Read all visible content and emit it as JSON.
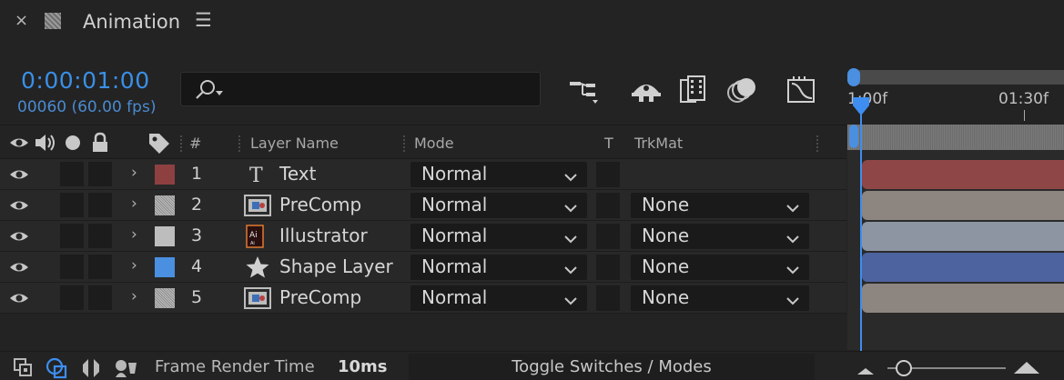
{
  "panel": {
    "close_glyph": "×",
    "title": "Animation",
    "menu_glyph": "☰",
    "icon": "composition-icon"
  },
  "time": {
    "timecode": "0:00:01:00",
    "frames_fps": "00060 (60.00 fps)"
  },
  "search": {
    "placeholder": "",
    "icon": "search-icon"
  },
  "toolbar": {
    "icons": [
      "composition-flowchart-icon",
      "draft-3d-icon",
      "frame-blending-icon",
      "motion-blur-icon",
      "graph-editor-icon"
    ]
  },
  "ruler": {
    "label_start": "1:00f",
    "label_end": "01:30f"
  },
  "columns": {
    "label": "#",
    "layer_name": "Layer Name",
    "mode": "Mode",
    "t": "T",
    "trkmat": "TrkMat"
  },
  "layers": [
    {
      "num": "1",
      "name": "Text",
      "type": "text-layer-icon",
      "label_color": "#8e4040",
      "mode": "Normal",
      "trkmat": null,
      "bar_color": "#8f4646"
    },
    {
      "num": "2",
      "name": "PreComp",
      "type": "precomp-icon",
      "label_color": "#b0aeae",
      "mode": "Normal",
      "trkmat": "None",
      "bar_color": "#8d8580"
    },
    {
      "num": "3",
      "name": "Illustrator",
      "type": "illustrator-file-icon",
      "label_color": "#bdbdbd",
      "mode": "Normal",
      "trkmat": "None",
      "bar_color": "#8e95a2"
    },
    {
      "num": "4",
      "name": "Shape Layer",
      "type": "shape-layer-icon",
      "label_color": "#4a8fe0",
      "mode": "Normal",
      "trkmat": "None",
      "bar_color": "#4d63a0"
    },
    {
      "num": "5",
      "name": "PreComp",
      "type": "precomp-icon",
      "label_color": "#b0aeae",
      "mode": "Normal",
      "trkmat": "None",
      "bar_color": "#8d8580"
    }
  ],
  "status": {
    "frame_render_label": "Frame Render Time",
    "frame_render_value": "10ms",
    "toggle_label": "Toggle Switches / Modes"
  },
  "colors": {
    "accent": "#3d8ef0",
    "background": "#232323"
  }
}
